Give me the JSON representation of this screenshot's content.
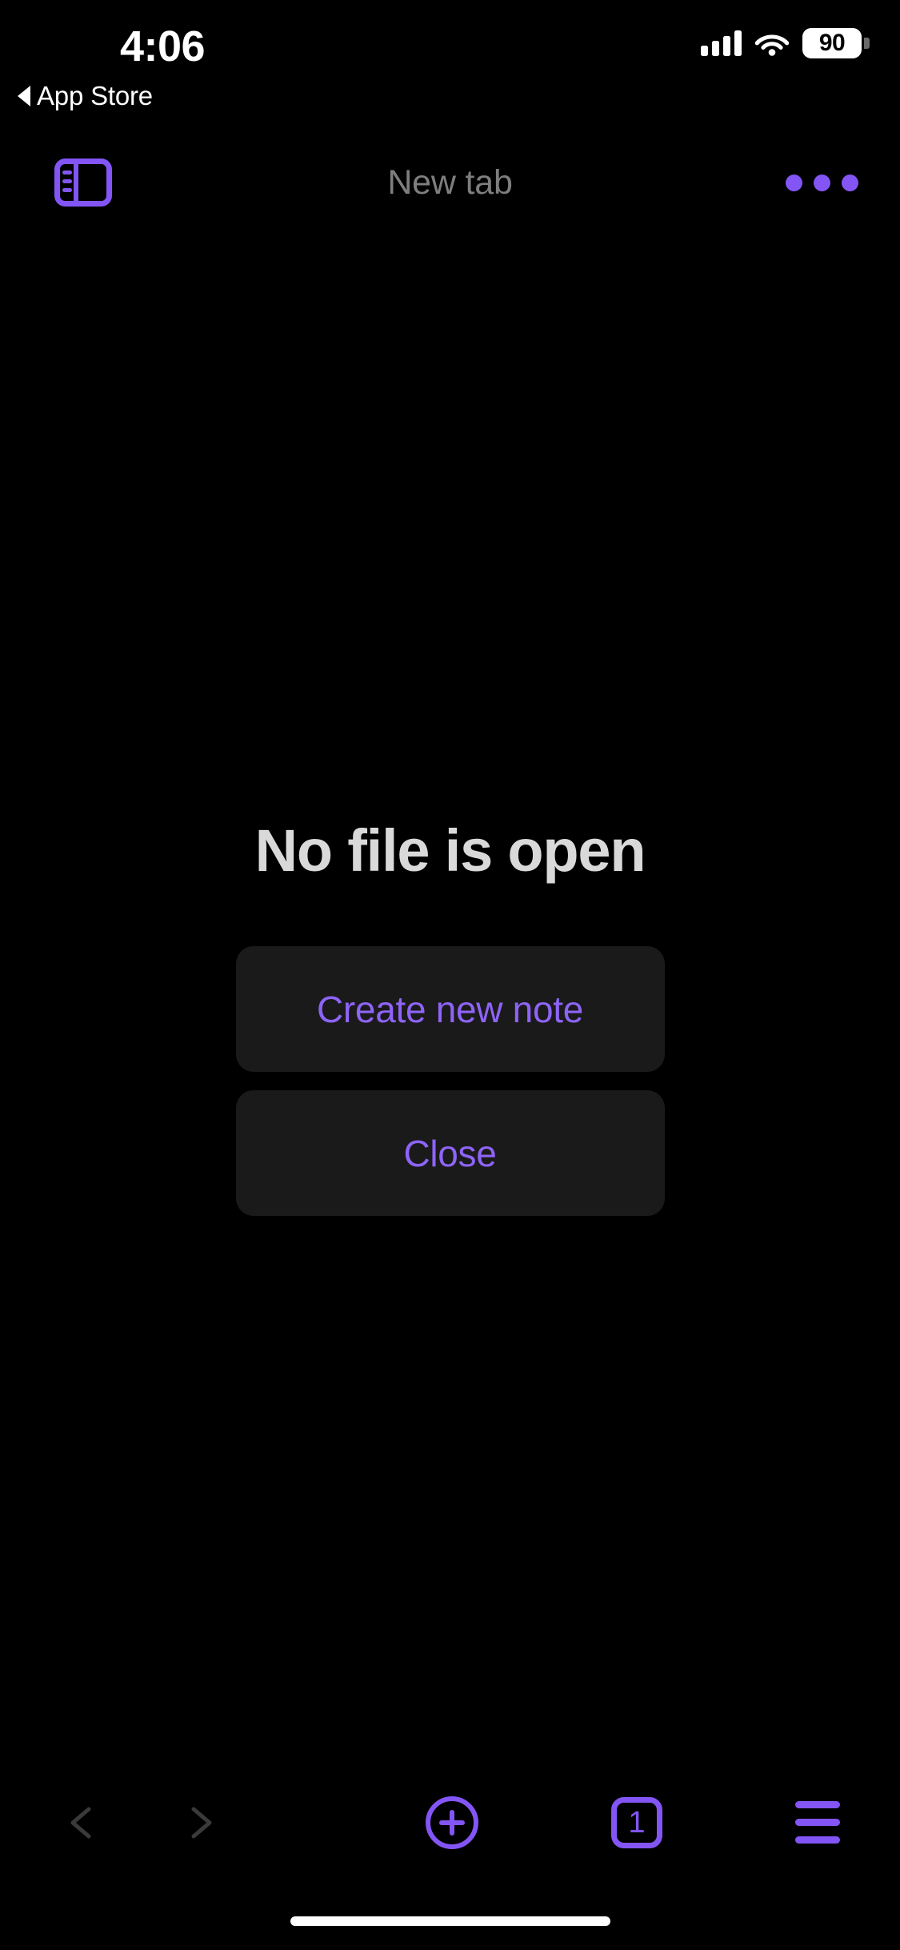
{
  "theme": {
    "background": "#000000",
    "accent_purple": "#8355f5",
    "button_purple_text": "#8e64f7",
    "surface": "#1a1a1a",
    "title_gray": "#7e7e7e",
    "heading_gray": "#d9d9d9",
    "disabled_gray": "#3a3a3a"
  },
  "status_bar": {
    "time": "4:06",
    "back_link_label": "App Store",
    "back_caret_icon": "left-triangle-icon",
    "cellular_icon": "cellular-signal-icon",
    "wifi_icon": "wifi-icon",
    "battery_level": "90",
    "battery_icon": "battery-icon"
  },
  "nav_bar": {
    "sidebar_toggle_icon": "sidebar-panel-icon",
    "title": "New tab",
    "more_icon": "more-horizontal-icon"
  },
  "empty_state": {
    "title": "No file is open",
    "buttons": [
      {
        "label": "Create new note",
        "name": "create-new-note-button"
      },
      {
        "label": "Close",
        "name": "close-button"
      }
    ]
  },
  "toolbar": {
    "back_icon": "chevron-left-icon",
    "back_enabled": false,
    "forward_icon": "chevron-right-icon",
    "forward_enabled": false,
    "new_tab_icon": "plus-circle-icon",
    "tab_count": "1",
    "tabs_icon": "tab-count-icon",
    "menu_icon": "hamburger-menu-icon"
  },
  "home_indicator": {
    "name": "home-indicator"
  }
}
